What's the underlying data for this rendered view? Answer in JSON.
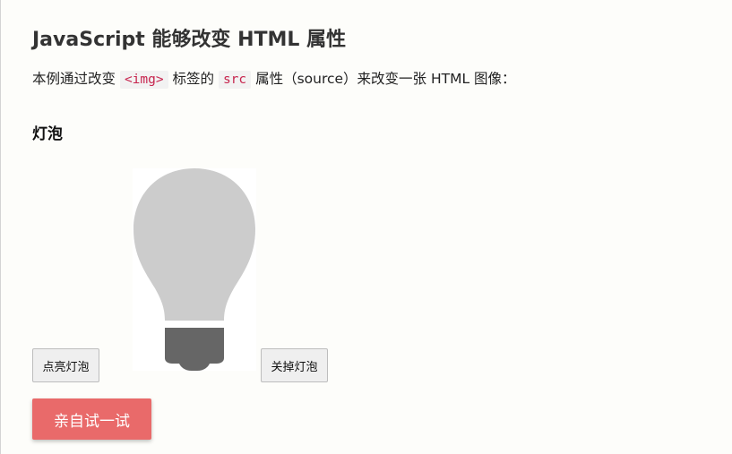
{
  "heading": "JavaScript 能够改变 HTML 属性",
  "intro": {
    "before_tag": "本例通过改变 ",
    "tag_code": "<img>",
    "between": " 标签的 ",
    "attr_code": "src",
    "after": " 属性（source）来改变一张 HTML 图像："
  },
  "section_title": "灯泡",
  "buttons": {
    "turn_on": "点亮灯泡",
    "turn_off": "关掉灯泡",
    "try_it": "亲自试一试"
  },
  "colors": {
    "try_button": "#e96a6a",
    "bulb_glass": "#cccccc",
    "bulb_base": "#666666",
    "code_text": "#c7254e"
  },
  "bulb_state": "off"
}
